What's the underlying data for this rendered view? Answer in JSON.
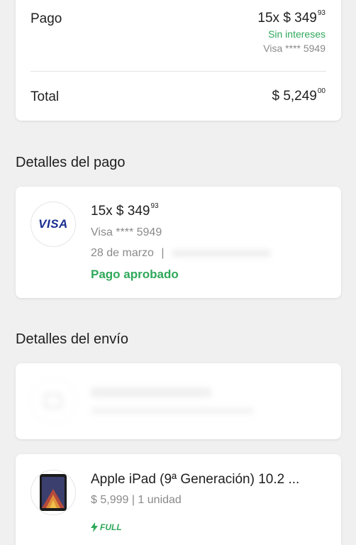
{
  "summary": {
    "pago_label": "Pago",
    "installments_prefix": "15x $ 349",
    "installments_cents": "93",
    "interest_note": "Sin intereses",
    "card_mask": "Visa **** 5949",
    "total_label": "Total",
    "total_amount": "$ 5,249",
    "total_cents": "00"
  },
  "payment_details": {
    "section_title": "Detalles del pago",
    "card_brand": "VISA",
    "installments_prefix": "15x $ 349",
    "installments_cents": "93",
    "card_mask": "Visa **** 5949",
    "date": "28 de marzo",
    "separator": "|",
    "status": "Pago aprobado"
  },
  "shipping_details": {
    "section_title": "Detalles del envío"
  },
  "product": {
    "title": "Apple iPad (9ª Generación) 10.2 ...",
    "price_qty": "$ 5,999 | 1 unidad",
    "shipping_badge": "FULL"
  },
  "colors": {
    "green": "#2fa85a",
    "visa_blue": "#1a2f8f"
  }
}
